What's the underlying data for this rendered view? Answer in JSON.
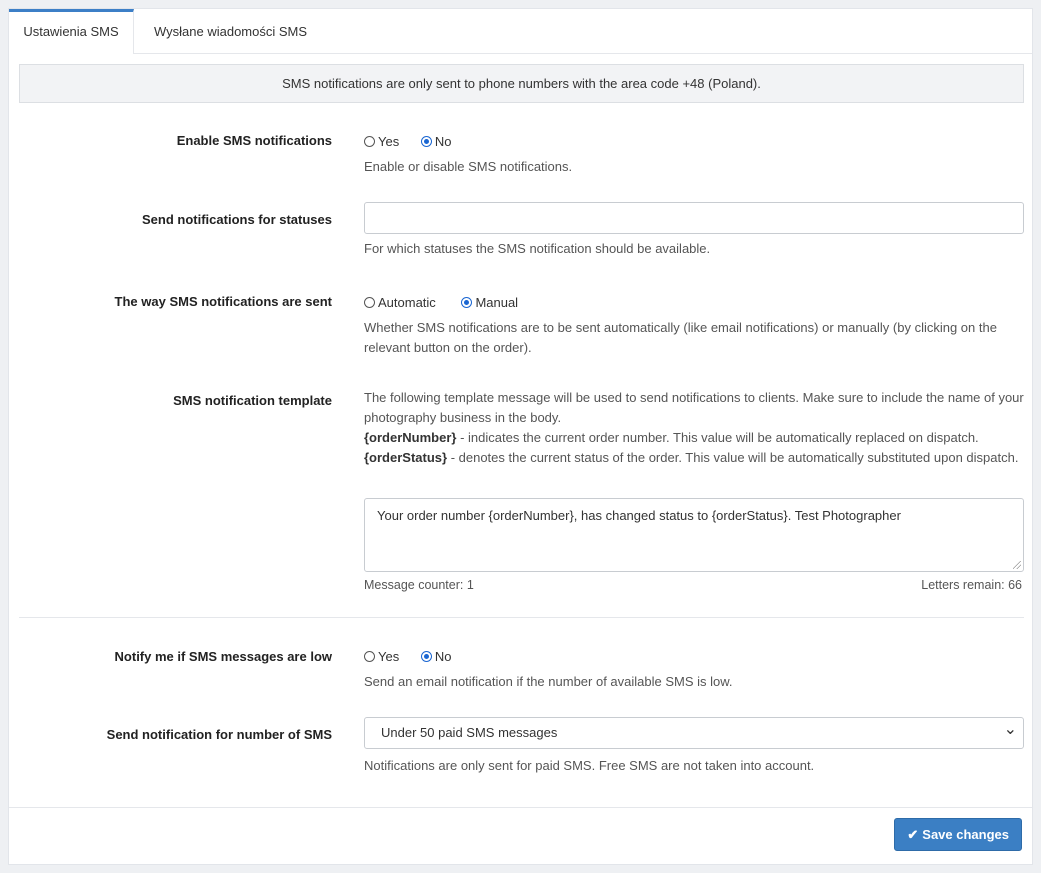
{
  "tabs": [
    {
      "label": "Ustawienia SMS",
      "active": true
    },
    {
      "label": "Wysłane wiadomości SMS",
      "active": false
    }
  ],
  "info": "SMS notifications are only sent to phone numbers with the area code +48 (Poland).",
  "enable": {
    "label": "Enable SMS notifications",
    "options": [
      "Yes",
      "No"
    ],
    "selected": "No",
    "help": "Enable or disable SMS notifications."
  },
  "statuses": {
    "label": "Send notifications for statuses",
    "value": "",
    "help": "For which statuses the SMS notification should be available."
  },
  "way": {
    "label": "The way SMS notifications are sent",
    "options": [
      "Automatic",
      "Manual"
    ],
    "selected": "Manual",
    "help": "Whether SMS notifications are to be sent automatically (like email notifications) or manually (by clicking on the relevant button on the order)."
  },
  "template": {
    "label": "SMS notification template",
    "help_intro": "The following template message will be used to send notifications to clients. Make sure to include the name of your photography business in the body.",
    "order_number_tag": "{orderNumber}",
    "order_number_desc": " - indicates the current order number. This value will be automatically replaced on dispatch.",
    "order_status_tag": "{orderStatus}",
    "order_status_desc": " - denotes the current status of the order. This value will be automatically substituted upon dispatch.",
    "value": "Your order number {orderNumber}, has changed status to {orderStatus}. Test Photographer",
    "counter": "Message counter: 1",
    "remain": "Letters remain: 66"
  },
  "low": {
    "label": "Notify me if SMS messages are low",
    "options": [
      "Yes",
      "No"
    ],
    "selected": "No",
    "help": "Send an email notification if the number of available SMS is low."
  },
  "threshold": {
    "label": "Send notification for number of SMS",
    "selected": "Under 50 paid SMS messages",
    "help": "Notifications are only sent for paid SMS. Free SMS are not taken into account."
  },
  "footer": {
    "save_label": "Save changes",
    "accent": "#3b7fc4"
  }
}
